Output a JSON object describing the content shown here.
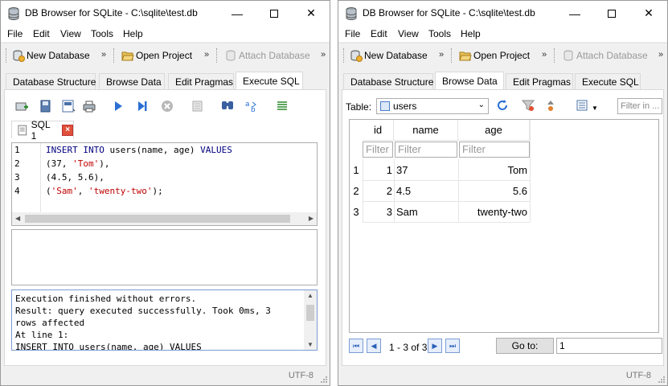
{
  "windows": [
    {
      "title": "DB Browser for SQLite - C:\\sqlite\\test.db",
      "menu": [
        "File",
        "Edit",
        "View",
        "Tools",
        "Help"
      ],
      "toolbar": {
        "new_db": "New Database",
        "open_project": "Open Project",
        "attach_db": "Attach Database"
      },
      "tabs": [
        "Database Structure",
        "Browse Data",
        "Edit Pragmas",
        "Execute SQL"
      ],
      "active_tab": "Execute SQL",
      "sql_tab": "SQL 1",
      "code_lines": [
        "1",
        "2",
        "3",
        "4"
      ],
      "code": {
        "l1_kw1": "INSERT INTO",
        "l1_rest": " users(name, age) ",
        "l1_kw2": "VALUES",
        "l2_a": "(37, ",
        "l2_s": "'Tom'",
        "l2_b": "),",
        "l3": "(4.5, 5.6),",
        "l4_a": "(",
        "l4_s1": "'Sam'",
        "l4_b": ", ",
        "l4_s2": "'twenty-two'",
        "l4_c": ");"
      },
      "messages": [
        "Execution finished without errors.",
        "Result: query executed successfully. Took 0ms, 3",
        "rows affected",
        "At line 1:",
        "INSERT INTO users(name, age) VALUES"
      ],
      "encoding": "UTF-8"
    },
    {
      "title": "DB Browser for SQLite - C:\\sqlite\\test.db",
      "menu": [
        "File",
        "Edit",
        "View",
        "Tools",
        "Help"
      ],
      "toolbar": {
        "new_db": "New Database",
        "open_project": "Open Project",
        "attach_db": "Attach Database"
      },
      "tabs": [
        "Database Structure",
        "Browse Data",
        "Edit Pragmas",
        "Execute SQL"
      ],
      "active_tab": "Browse Data",
      "table_label": "Table:",
      "table_selected": "users",
      "filter_placeholder": "Filter in ...",
      "columns": [
        "id",
        "name",
        "age"
      ],
      "filter_text": "Filter",
      "rows": [
        {
          "n": "1",
          "id": "1",
          "name": "37",
          "age": "Tom"
        },
        {
          "n": "2",
          "id": "2",
          "name": "4.5",
          "age": "5.6"
        },
        {
          "n": "3",
          "id": "3",
          "name": "Sam",
          "age": "twenty-two"
        }
      ],
      "page_info": "1 - 3 of 3",
      "goto_label": "Go to:",
      "goto_value": "1",
      "encoding": "UTF-8"
    }
  ]
}
